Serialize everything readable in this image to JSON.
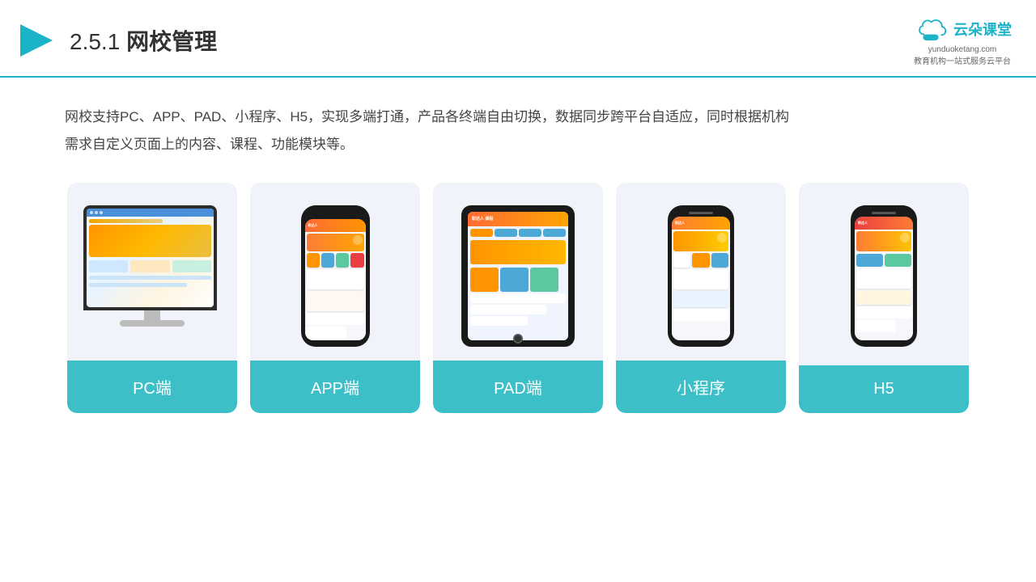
{
  "header": {
    "section_number": "2.5.1",
    "title": "网校管理",
    "logo_name": "云朵课堂",
    "logo_url": "yunduoketang.com",
    "logo_slogan": "教育机构一站\n式服务云平台"
  },
  "description": {
    "text1": "网校支持PC、APP、PAD、小程序、H5，实现多端打通，产品各终端自由切换，数据同步跨平台自适应，同时根据机构",
    "text2": "需求自定义页面上的内容、课程、功能模块等。"
  },
  "cards": [
    {
      "id": "pc",
      "label": "PC端"
    },
    {
      "id": "app",
      "label": "APP端"
    },
    {
      "id": "pad",
      "label": "PAD端"
    },
    {
      "id": "miniprogram",
      "label": "小程序"
    },
    {
      "id": "h5",
      "label": "H5"
    }
  ],
  "colors": {
    "accent": "#1ab3c8",
    "card_bg": "#eef2f8",
    "card_label_bg": "#3dbfc8",
    "divider": "#1ab3c8"
  }
}
